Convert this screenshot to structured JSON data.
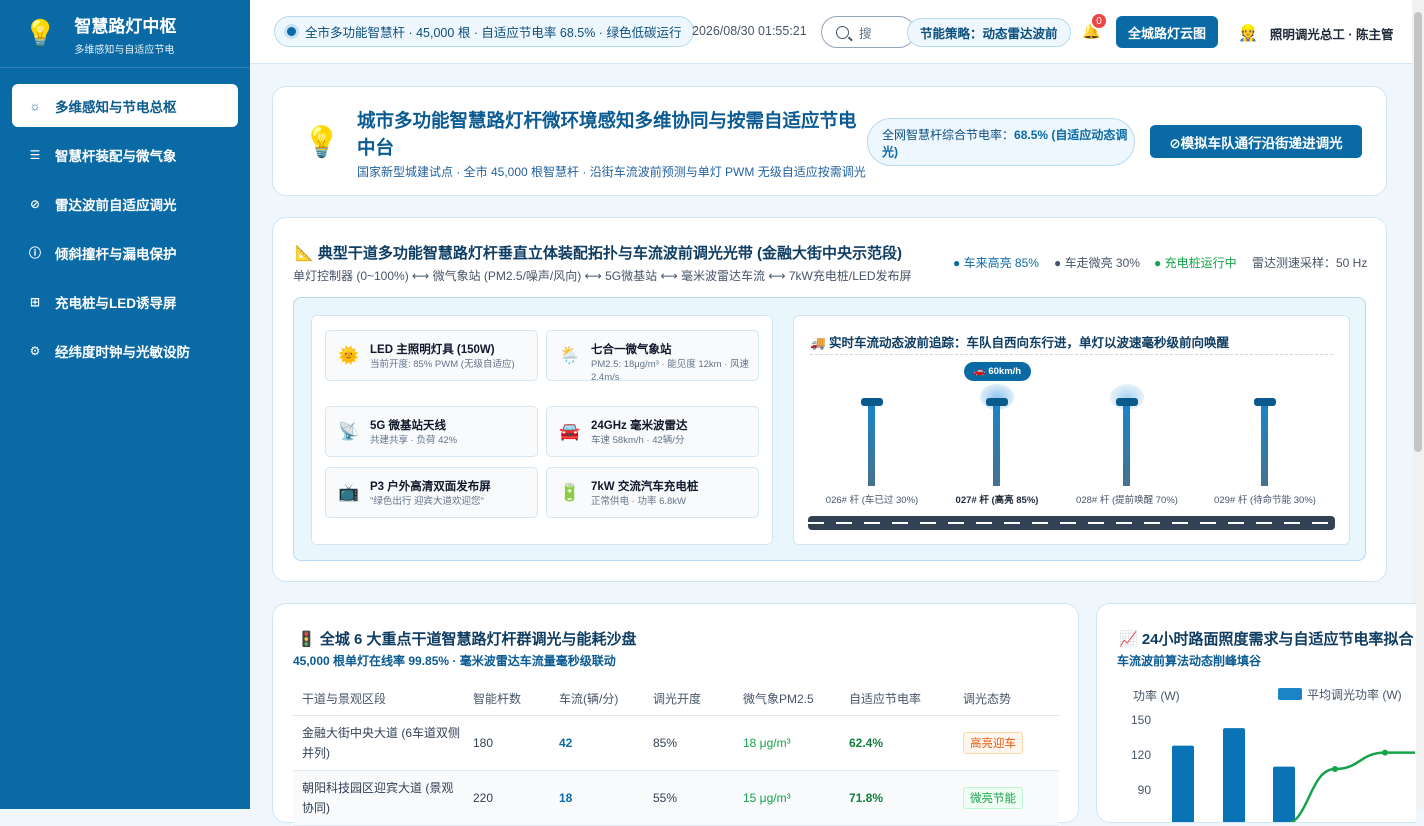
{
  "sidebar": {
    "title": "智慧路灯中枢",
    "subtitle": "多维感知与自适应节电",
    "items": [
      {
        "label": "多维感知与节电总枢",
        "icon": "☼"
      },
      {
        "label": "智慧杆装配与微气象",
        "icon": "☰"
      },
      {
        "label": "雷达波前自适应调光",
        "icon": "⊘"
      },
      {
        "label": "倾斜撞杆与漏电保护",
        "icon": "ⓘ"
      },
      {
        "label": "充电桩与LED诱导屏",
        "icon": "⊞"
      },
      {
        "label": "经纬度时钟与光敏设防",
        "icon": "⚙"
      }
    ]
  },
  "topbar": {
    "status": "全市多功能智慧杆 · 45,000 根 · 自适应节电率 68.5% · 绿色低碳运行",
    "datetime": "2026/08/30 01:55:21",
    "search_placeholder": "搜",
    "strategy": "节能策略：动态雷达波前",
    "notification_count": "0",
    "cloud_button": "全城路灯云图",
    "user": "照明调光总工 · 陈主管"
  },
  "hero": {
    "title": "城市多功能智慧路灯杆微环境感知多维协同与按需自适应节电中台",
    "subtitle": "国家新型城建试点 · 全市 45,000 根智慧杆 · 沿街车流波前预测与单灯 PWM 无级自适应按需调光",
    "rate_label": "全网智慧杆综合节电率：",
    "rate_value": "68.5% (自适应动态调光)",
    "button": "⊘模拟车队通行沿街递进调光"
  },
  "topology": {
    "title": "典型干道多功能智慧路灯杆垂直立体装配拓扑与车流波前调光光带 (金融大街中央示范段)",
    "subtitle": "单灯控制器 (0~100%) ⟷ 微气象站 (PM2.5/噪声/风向) ⟷ 5G微基站 ⟷ 毫米波雷达车流 ⟷ 7kW充电桩/LED发布屏",
    "legend": [
      "● 车来高亮 85%",
      "● 车走微亮 30%",
      "● 充电桩运行中",
      "雷达测速采样：50 Hz"
    ],
    "modules": [
      {
        "icon": "🌞",
        "title": "LED 主照明灯具 (150W)",
        "desc": "当前开度: 85% PWM (无级自适应)"
      },
      {
        "icon": "🌦️",
        "title": "七合一微气象站",
        "desc": "PM2.5: 18μg/m³ · 能见度 12km · 风速 2.4m/s"
      },
      {
        "icon": "📡",
        "title": "5G 微基站天线",
        "desc": "共建共享 · 负荷 42%"
      },
      {
        "icon": "🚘",
        "title": "24GHz 毫米波雷达",
        "desc": "车速 58km/h · 42辆/分"
      },
      {
        "icon": "📺",
        "title": "P3 户外高清双面发布屏",
        "desc": "\"绿色出行 迎宾大道欢迎您\""
      },
      {
        "icon": "🔋",
        "title": "7kW 交流汽车充电桩",
        "desc": "正常供电 · 功率 6.8kW"
      }
    ],
    "track_title": "🚚 实时车流动态波前追踪：车队自西向东行进，单灯以波速毫秒级前向唤醒",
    "speed": "🚗 60km/h",
    "poles": [
      {
        "label": "026# 杆 (车已过 30%)",
        "level": 0.3
      },
      {
        "label": "027# 杆 (高亮 85%)",
        "level": 0.85
      },
      {
        "label": "028# 杆 (提前唤醒 70%)",
        "level": 0.7
      },
      {
        "label": "029# 杆 (待命节能 30%)",
        "level": 0.3
      }
    ]
  },
  "districts": {
    "title": "🚦 全城 6 大重点干道智慧路灯杆群调光与能耗沙盘",
    "subtitle": "45,000 根单灯在线率 99.85% · 毫米波雷达车流量毫秒级联动",
    "headers": [
      "干道与景观区段",
      "智能杆数",
      "车流(辆/分)",
      "调光开度",
      "微气象PM2.5",
      "自适应节电率",
      "调光态势"
    ],
    "rows": [
      [
        "金融大街中央大道 (6车道双侧并列)",
        "180",
        "42",
        "85%",
        "18 μg/m³",
        "62.4%",
        "高亮迎车"
      ],
      [
        "朝阳科技园区迎宾大道 (景观协同)",
        "220",
        "18",
        "55%",
        "15 μg/m³",
        "71.8%",
        "微亮节能"
      ]
    ]
  },
  "chart": {
    "title": "📈 24小时路面照度需求与自适应节电率拟合",
    "subtitle": "车流波前算法动态削峰填谷",
    "ylabel": "功率 (W)",
    "legend": "平均调光功率 (W)"
  },
  "chart_data": {
    "type": "bar",
    "title": "24小时路面照度需求与自适应节电率拟合",
    "ylabel": "功率 (W)",
    "yticks": [
      150,
      120,
      90
    ],
    "ylim": [
      60,
      150
    ],
    "series": [
      {
        "name": "平均调光功率 (W)",
        "type": "bar",
        "values": [
          128,
          143,
          110
        ]
      },
      {
        "type": "line",
        "values": [
          60,
          108,
          122,
          122
        ]
      }
    ],
    "colors": {
      "bar": "#0a73b5",
      "line": "#16a34a"
    }
  }
}
